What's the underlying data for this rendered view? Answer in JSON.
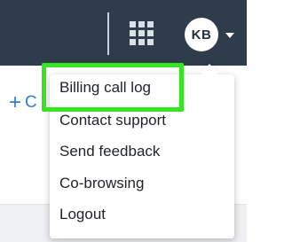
{
  "topbar": {
    "icons": [
      "apps-grid-icon"
    ],
    "avatar_initials": "KB",
    "avatar_caret_icon": "caret-down-icon"
  },
  "content": {
    "create_link_icon": "plus-icon",
    "create_link_label": "C"
  },
  "user_menu": {
    "items": [
      {
        "label": "Billing call log",
        "highlighted": true
      },
      {
        "label": "Contact support"
      },
      {
        "label": "Send feedback"
      },
      {
        "label": "Co-browsing"
      },
      {
        "label": "Logout"
      }
    ]
  },
  "colors": {
    "topbar": "#2f3c4b",
    "highlight": "#35e51f",
    "link": "#2f80c8"
  }
}
